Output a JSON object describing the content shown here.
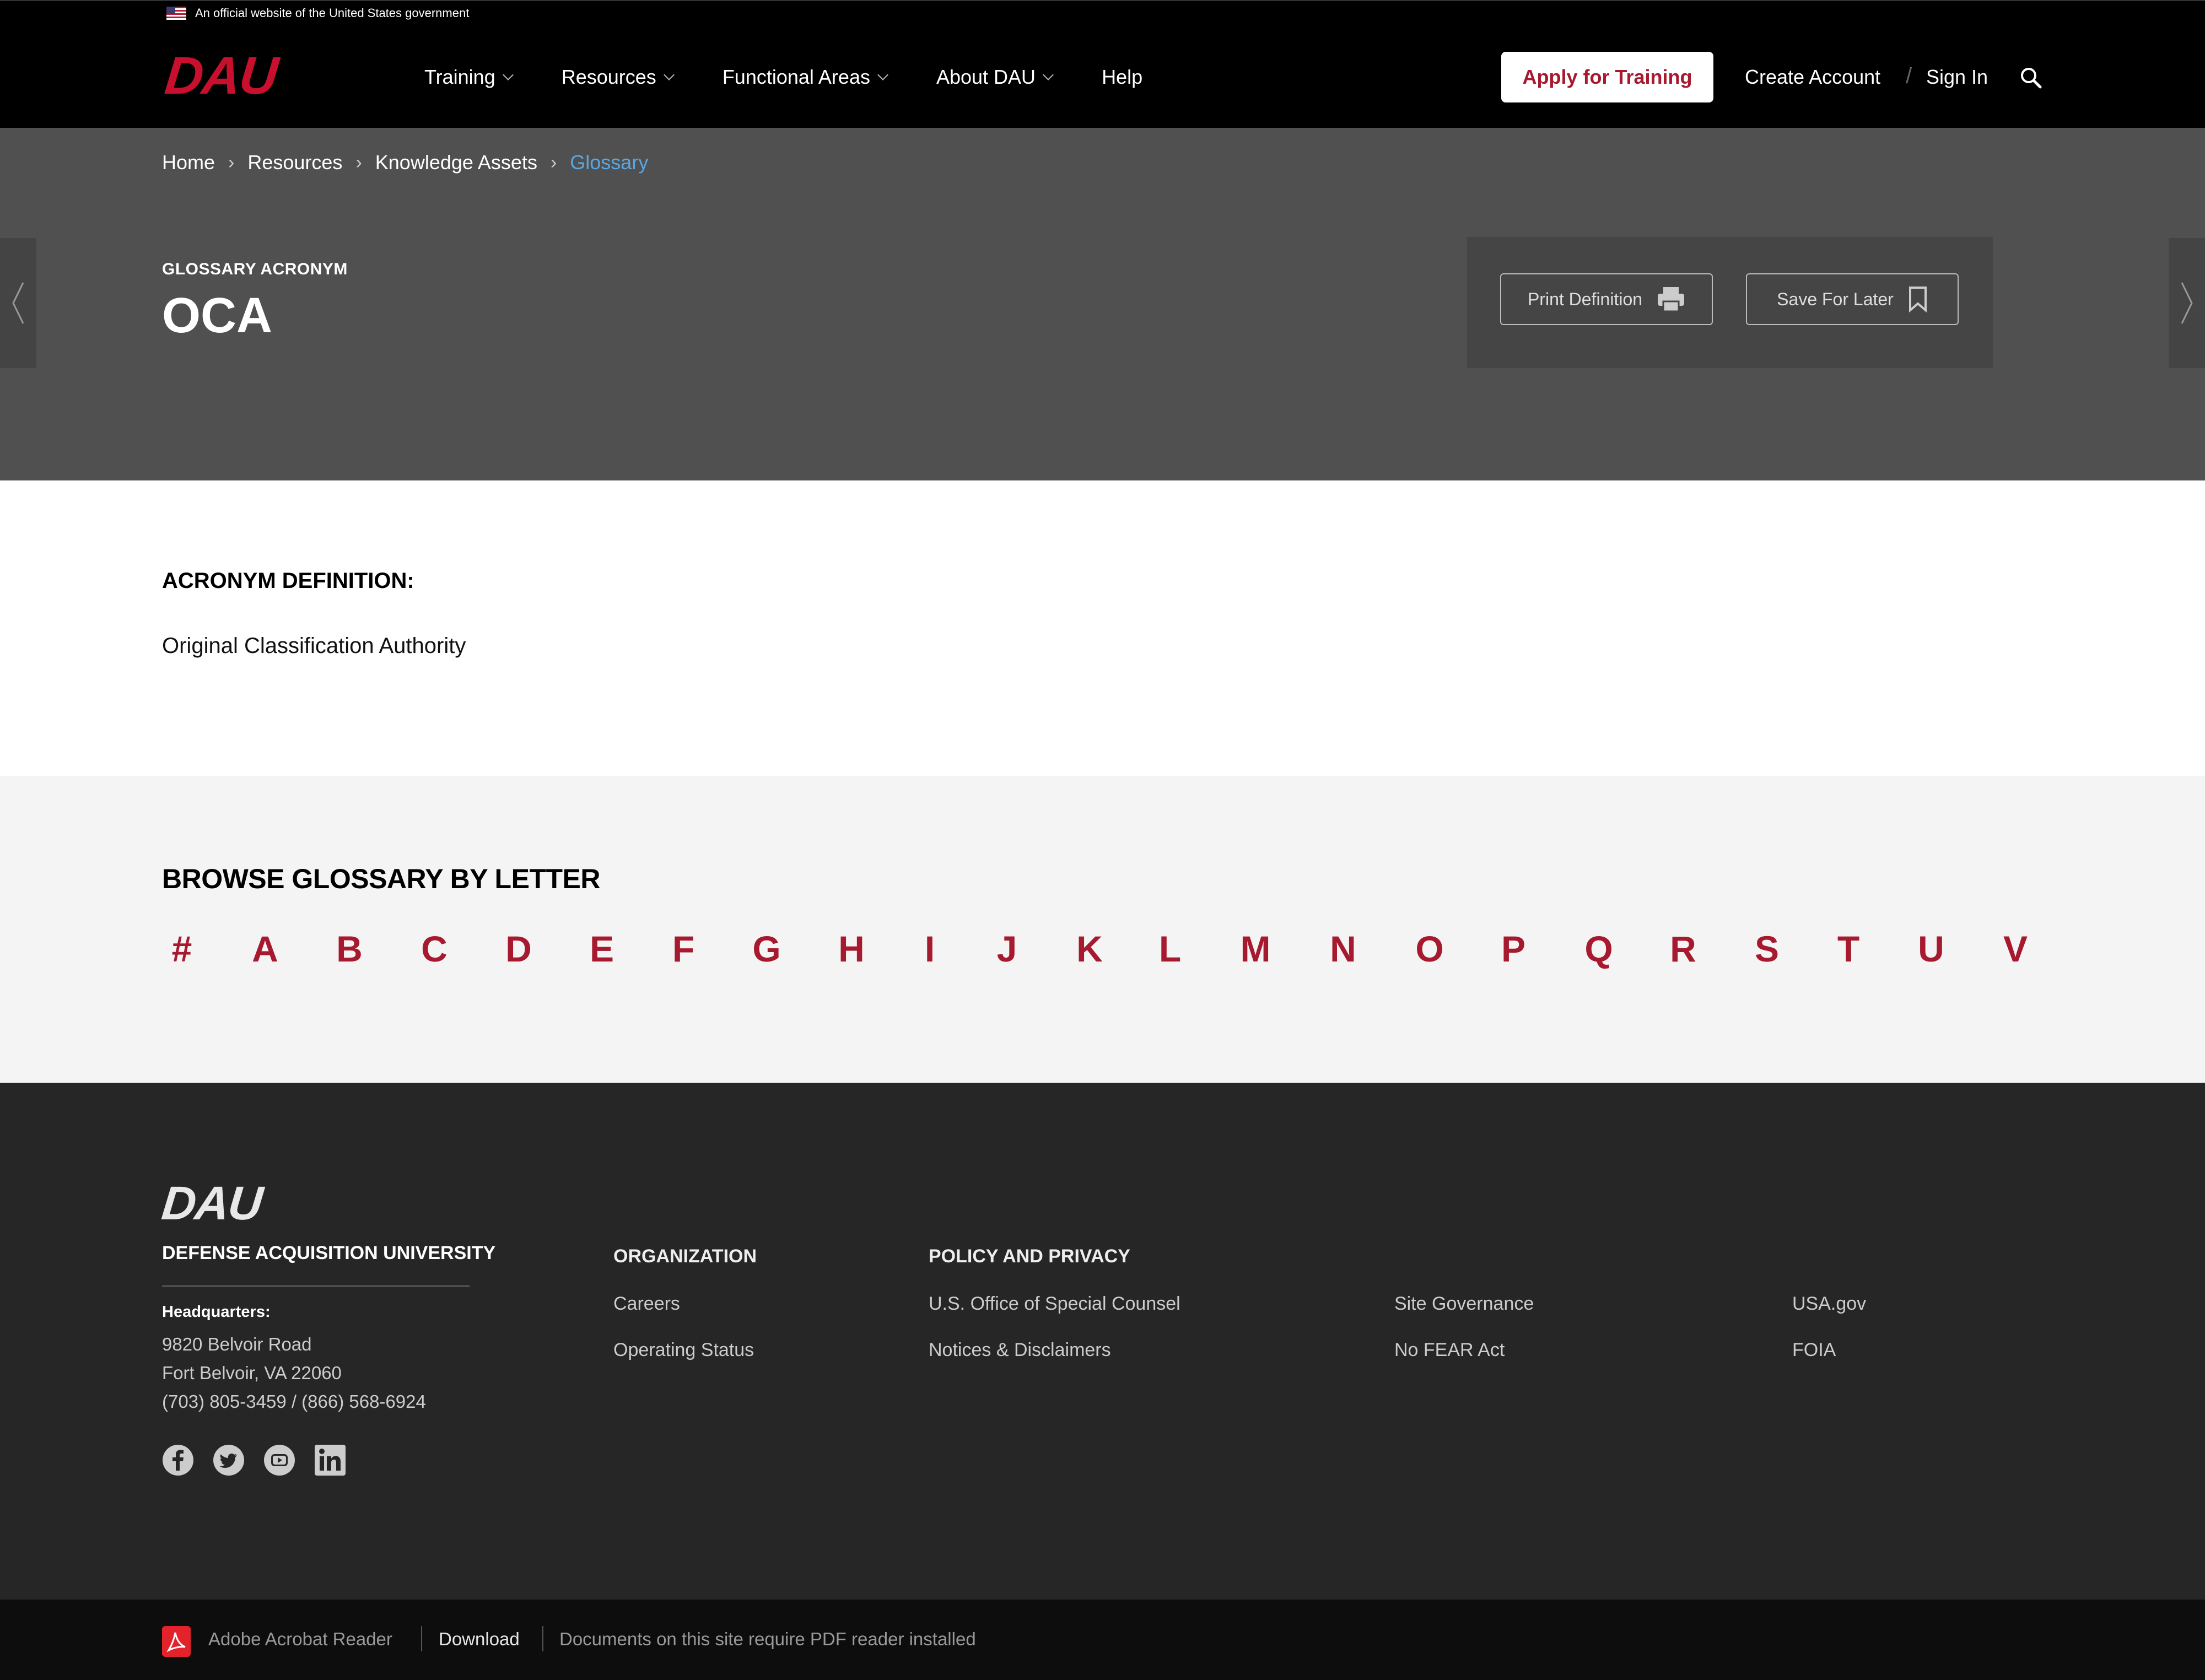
{
  "gov_banner": {
    "text": "An official website of the United States government"
  },
  "header": {
    "logo": "DAU",
    "nav": [
      {
        "label": "Training",
        "has_dropdown": true
      },
      {
        "label": "Resources",
        "has_dropdown": true
      },
      {
        "label": "Functional Areas",
        "has_dropdown": true
      },
      {
        "label": "About DAU",
        "has_dropdown": true
      },
      {
        "label": "Help",
        "has_dropdown": false
      }
    ],
    "apply_label": "Apply for Training",
    "create_account_label": "Create Account",
    "separator": "/",
    "sign_in_label": "Sign In"
  },
  "breadcrumb": {
    "items": [
      "Home",
      "Resources",
      "Knowledge Assets"
    ],
    "current": "Glossary"
  },
  "hero": {
    "label": "GLOSSARY ACRONYM",
    "title": "OCA",
    "print_label": "Print Definition",
    "save_label": "Save For Later"
  },
  "definition": {
    "heading": "ACRONYM DEFINITION:",
    "text": "Original Classification Authority"
  },
  "browse": {
    "heading": "BROWSE GLOSSARY BY LETTER",
    "letters": [
      "#",
      "A",
      "B",
      "C",
      "D",
      "E",
      "F",
      "G",
      "H",
      "I",
      "J",
      "K",
      "L",
      "M",
      "N",
      "O",
      "P",
      "Q",
      "R",
      "S",
      "T",
      "U",
      "V"
    ]
  },
  "footer": {
    "logo": "DAU",
    "name": "DEFENSE ACQUISITION UNIVERSITY",
    "hq_label": "Headquarters:",
    "address": [
      "9820 Belvoir Road",
      "Fort Belvoir, VA 22060",
      "(703) 805-3459 / (866) 568-6924"
    ],
    "socials": [
      "facebook-icon",
      "twitter-icon",
      "youtube-icon",
      "linkedin-icon"
    ],
    "organization": {
      "heading": "ORGANIZATION",
      "links": [
        "Careers",
        "Operating Status"
      ]
    },
    "policy": {
      "heading": "POLICY AND PRIVACY",
      "links": [
        "U.S. Office of Special Counsel",
        "Notices & Disclaimers",
        "Site Governance",
        "No FEAR Act",
        "USA.gov",
        "FOIA"
      ]
    }
  },
  "bottom_bar": {
    "reader": "Adobe Acrobat Reader",
    "download": "Download",
    "note": "Documents on this site require PDF reader installed"
  },
  "colors": {
    "brand_red": "#a6192e",
    "link_blue": "#5aa7e0",
    "hero_gray": "#505050",
    "footer_dark": "#262626"
  }
}
